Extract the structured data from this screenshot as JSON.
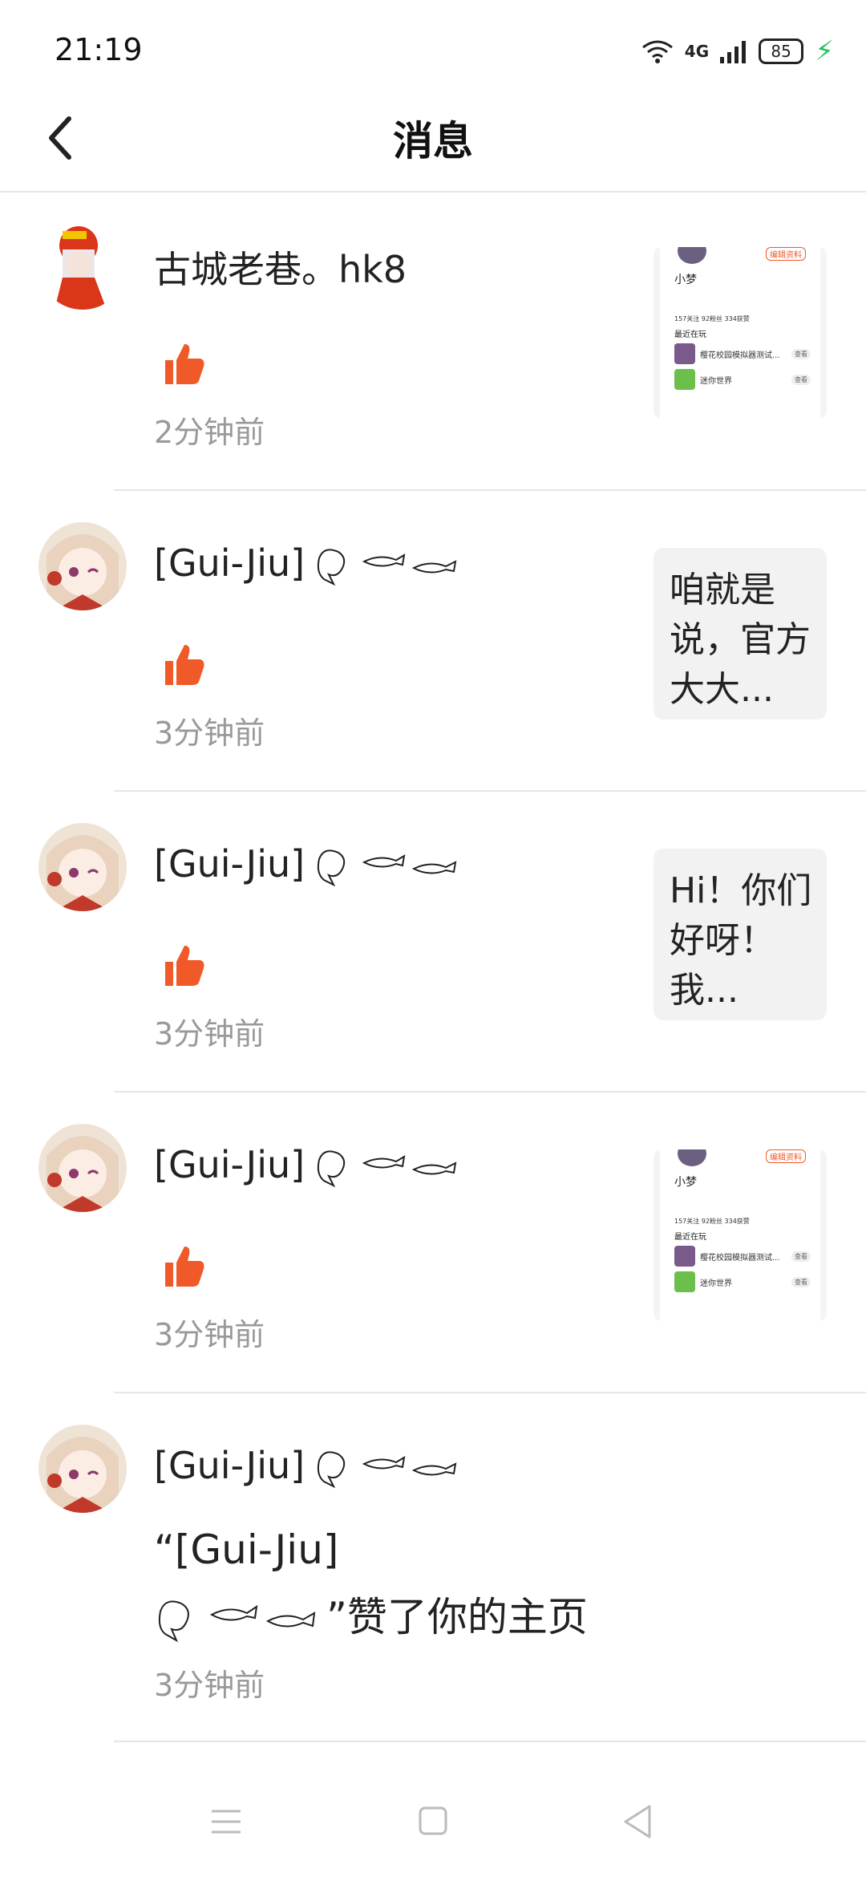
{
  "status_bar": {
    "time": "21:19",
    "network": "4G",
    "battery": "85"
  },
  "header": {
    "title": "消息",
    "back_icon": "chevron-left-icon"
  },
  "messages": [
    {
      "name": "古城老巷。hk8",
      "time": "2分钟前",
      "preview_type": "screenshot",
      "screenshot": {
        "profile_name": "小梦",
        "badge": "编辑资料",
        "stats": "157关注 92粉丝 334获赞",
        "section": "最近在玩",
        "game1": "樱花校园模拟器测试...",
        "game2": "迷你世界",
        "button": "查看"
      }
    },
    {
      "name": "[Gui-Jiu]",
      "time": "3分钟前",
      "preview_type": "text",
      "preview_text": "咱就是说，官方大大..."
    },
    {
      "name": "[Gui-Jiu]",
      "time": "3分钟前",
      "preview_type": "text",
      "preview_text": "Hi！你们好呀！我..."
    },
    {
      "name": "[Gui-Jiu]",
      "time": "3分钟前",
      "preview_type": "screenshot",
      "screenshot": {
        "profile_name": "小梦",
        "badge": "编辑资料",
        "stats": "157关注 92粉丝 334获赞",
        "section": "最近在玩",
        "game1": "樱花校园模拟器测试...",
        "game2": "迷你世界",
        "button": "查看"
      }
    },
    {
      "name": "[Gui-Jiu]",
      "time": "3分钟前",
      "body_line1": "“[Gui-Jiu]",
      "body_line2": "”赞了你的主页"
    }
  ],
  "nav_bar": {
    "menu_icon": "menu-icon",
    "home_icon": "home-square-icon",
    "back_icon": "back-triangle-icon"
  },
  "colors": {
    "accent": "#f05a28",
    "muted": "#999999",
    "divider": "#e6e6e6"
  }
}
